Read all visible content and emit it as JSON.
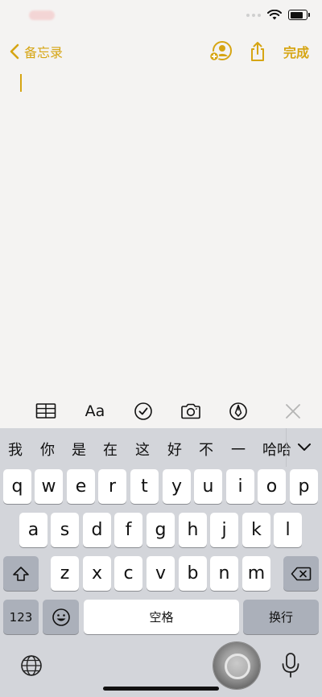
{
  "nav": {
    "back_label": "备忘录",
    "done_label": "完成",
    "share_icon": "share-icon",
    "collab_icon": "add-person-icon"
  },
  "toolbar": {
    "format_label": "Aa",
    "icons": [
      "table-icon",
      "format-icon",
      "checklist-icon",
      "camera-icon",
      "markup-pen-icon",
      "close-icon"
    ]
  },
  "keyboard": {
    "candidates": [
      "我",
      "你",
      "是",
      "在",
      "这",
      "好",
      "不",
      "一",
      "哈哈"
    ],
    "row1": [
      "q",
      "w",
      "e",
      "r",
      "t",
      "y",
      "u",
      "i",
      "o",
      "p"
    ],
    "row2": [
      "a",
      "s",
      "d",
      "f",
      "g",
      "h",
      "j",
      "k",
      "l"
    ],
    "row3": [
      "z",
      "x",
      "c",
      "v",
      "b",
      "n",
      "m"
    ],
    "numbers_label": "123",
    "space_label": "空格",
    "return_label": "换行"
  },
  "colors": {
    "accent": "#d6a513",
    "keyboard_bg": "#d3d5da",
    "key_bg": "#ffffff",
    "dark_key_bg": "#abb0ba",
    "page_bg": "#f4f3f2"
  }
}
